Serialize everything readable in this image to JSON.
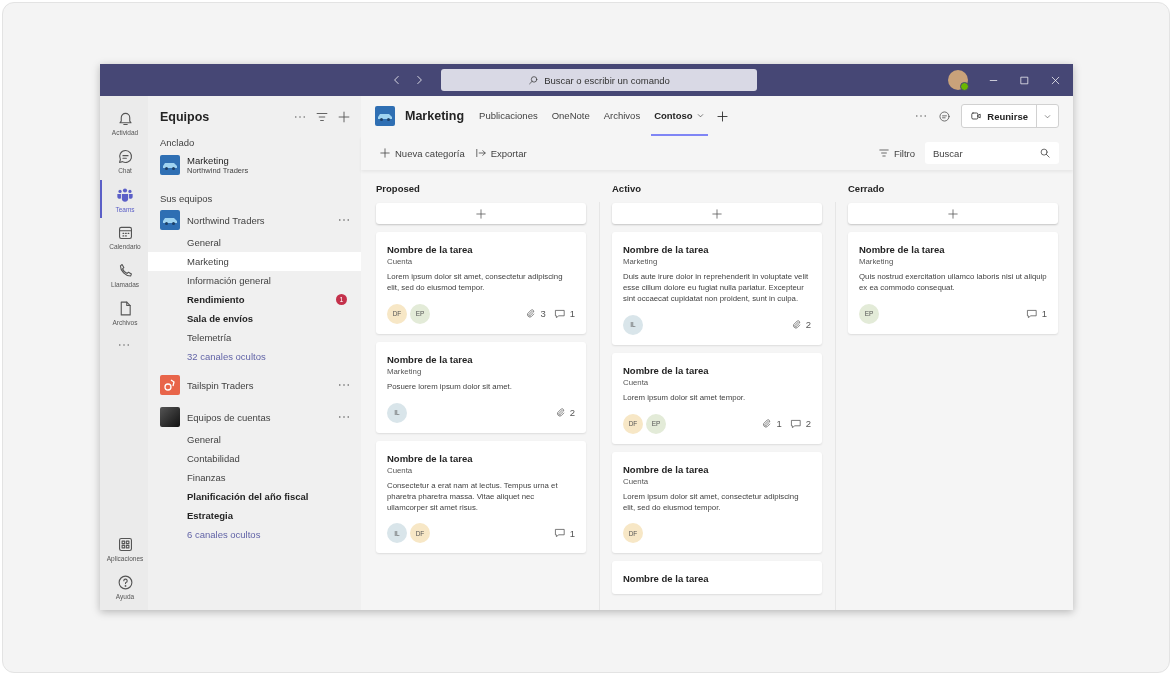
{
  "title_bar": {
    "search_placeholder": "Buscar o escribir un comando"
  },
  "rail": {
    "items": [
      {
        "label": "Actividad",
        "selected": false
      },
      {
        "label": "Chat",
        "selected": false
      },
      {
        "label": "Teams",
        "selected": true
      },
      {
        "label": "Calendario",
        "selected": false
      },
      {
        "label": "Llamadas",
        "selected": false
      },
      {
        "label": "Archivos",
        "selected": false
      }
    ],
    "bottom_items": [
      {
        "label": "Aplicaciones"
      },
      {
        "label": "Ayuda"
      }
    ]
  },
  "sidebar": {
    "title": "Equipos",
    "pinned_label": "Anclado",
    "pinned": [
      {
        "name": "Marketing",
        "subtitle": "Northwind Traders",
        "kind": "car"
      }
    ],
    "teams_label": "Sus equipos",
    "teams": [
      {
        "name": "Northwind Traders",
        "kind": "car",
        "channels": [
          {
            "name": "General",
            "selected": false,
            "unread": false
          },
          {
            "name": "Marketing",
            "selected": true,
            "unread": false
          },
          {
            "name": "Información general",
            "selected": false,
            "unread": false
          },
          {
            "name": "Rendimiento",
            "selected": false,
            "unread": true,
            "badge": "1"
          },
          {
            "name": "Sala de envíos",
            "selected": false,
            "unread": true
          },
          {
            "name": "Telemetría",
            "selected": false,
            "unread": false
          }
        ],
        "hidden_channels": "32 canales ocultos"
      },
      {
        "name": "Tailspin Traders",
        "kind": "logo"
      },
      {
        "name": "Equipos de cuentas",
        "kind": "photo",
        "channels": [
          {
            "name": "General",
            "selected": false,
            "unread": false
          },
          {
            "name": "Contabilidad",
            "selected": false,
            "unread": false
          },
          {
            "name": "Finanzas",
            "selected": false,
            "unread": false
          },
          {
            "name": "Planificación del año fiscal",
            "selected": false,
            "unread": true
          },
          {
            "name": "Estrategia",
            "selected": false,
            "unread": true
          }
        ],
        "hidden_channels": "6 canales ocultos"
      }
    ]
  },
  "channel_header": {
    "title": "Marketing",
    "tabs": [
      {
        "label": "Publicaciones",
        "selected": false,
        "dropdown": false
      },
      {
        "label": "OneNote",
        "selected": false,
        "dropdown": false
      },
      {
        "label": "Archivos",
        "selected": false,
        "dropdown": false
      },
      {
        "label": "Contoso",
        "selected": true,
        "dropdown": true
      }
    ],
    "meet_button": "Reunirse"
  },
  "toolbar": {
    "new_category": "Nueva categoría",
    "export": "Exportar",
    "filter": "Filtro",
    "search_placeholder": "Buscar"
  },
  "columns": [
    {
      "title": "Proposed",
      "cards": [
        {
          "title": "Nombre de la tarea",
          "subtitle": "Cuenta",
          "body": "Lorem ipsum dolor sit amet, consectetur adipiscing elit, sed do eiusmod tempor.",
          "assignees": [
            {
              "initials": "DF",
              "color": "#f7e7c6"
            },
            {
              "initials": "EP",
              "color": "#e3ebd8"
            }
          ],
          "attachments": "3",
          "comments": "1"
        },
        {
          "title": "Nombre de la tarea",
          "subtitle": "Marketing",
          "body": "Posuere lorem ipsum dolor sit amet.",
          "assignees": [
            {
              "initials": "IL",
              "color": "#d9e5ea"
            }
          ],
          "attachments": "2"
        },
        {
          "title": "Nombre de la tarea",
          "subtitle": "Cuenta",
          "body": "Consectetur a erat nam at lectus. Tempus urna et pharetra pharetra massa. Vitae aliquet nec ullamcorper sit amet risus.",
          "assignees": [
            {
              "initials": "IL",
              "color": "#d9e5ea"
            },
            {
              "initials": "DF",
              "color": "#f7e7c6"
            }
          ],
          "comments": "1"
        }
      ]
    },
    {
      "title": "Activo",
      "cards": [
        {
          "title": "Nombre de la tarea",
          "subtitle": "Marketing",
          "body": "Duis aute irure dolor in reprehenderit in voluptate velit esse cillum dolore eu fugiat nulla pariatur. Excepteur sint occaecat cupidatat non proident, sunt in culpa.",
          "assignees": [
            {
              "initials": "IL",
              "color": "#d9e5ea"
            }
          ],
          "attachments": "2"
        },
        {
          "title": "Nombre de la tarea",
          "subtitle": "Cuenta",
          "body": "Lorem ipsum dolor sit amet tempor.",
          "assignees": [
            {
              "initials": "DF",
              "color": "#f7e7c6"
            },
            {
              "initials": "EP",
              "color": "#e3ebd8"
            }
          ],
          "attachments": "1",
          "comments": "2"
        },
        {
          "title": "Nombre de la tarea",
          "subtitle": "Cuenta",
          "body": "Lorem ipsum dolor sit amet, consectetur adipiscing elit, sed do eiusmod tempor.",
          "assignees": [
            {
              "initials": "DF",
              "color": "#f7e7c6"
            }
          ]
        },
        {
          "title": "Nombre de la tarea"
        }
      ]
    },
    {
      "title": "Cerrado",
      "cards": [
        {
          "title": "Nombre de la tarea",
          "subtitle": "Marketing",
          "body": "Quis nostrud exercitation ullamco laboris nisi ut aliquip ex ea commodo consequat.",
          "assignees": [
            {
              "initials": "EP",
              "color": "#e3ebd8"
            }
          ],
          "comments": "1"
        }
      ]
    }
  ]
}
